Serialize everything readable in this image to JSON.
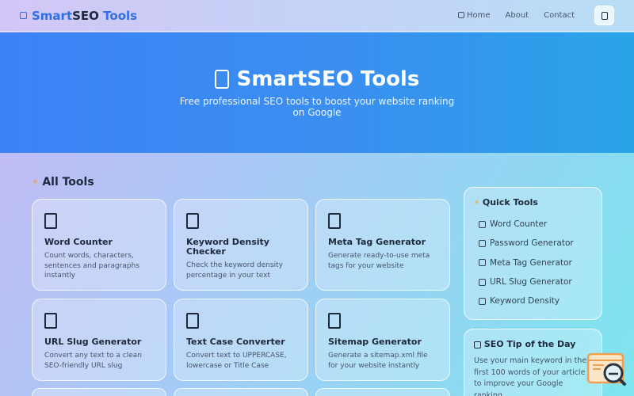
{
  "header": {
    "brand_part1": "Smart",
    "brand_part2": "SEO",
    "brand_part3": "Tools",
    "brand_icon": "rocket-icon",
    "nav": [
      {
        "label": "Home",
        "icon": "home-icon"
      },
      {
        "label": "About"
      },
      {
        "label": "Contact"
      }
    ],
    "menu_button_icon": "moon-icon"
  },
  "hero": {
    "title": "SmartSEO Tools",
    "title_icon": "rocket-icon",
    "subtitle": "Free professional SEO tools to boost your website ranking on Google"
  },
  "tools_section": {
    "title": "All Tools",
    "title_icon": "lightning-icon",
    "cards": [
      {
        "title": "Word Counter",
        "desc": "Count words, characters, sentences and paragraphs instantly",
        "icon": "notepad-icon"
      },
      {
        "title": "Keyword Density Checker",
        "desc": "Check the keyword density percentage in your text",
        "icon": "magnifier-icon"
      },
      {
        "title": "Meta Tag Generator",
        "desc": "Generate ready-to-use meta tags for your website",
        "icon": "tag-icon"
      },
      {
        "title": "URL Slug Generator",
        "desc": "Convert any text to a clean SEO-friendly URL slug",
        "icon": "link-icon"
      },
      {
        "title": "Text Case Converter",
        "desc": "Convert text to UPPERCASE, lowercase or Title Case",
        "icon": "letters-icon"
      },
      {
        "title": "Sitemap Generator",
        "desc": "Generate a sitemap.xml file for your website instantly",
        "icon": "map-icon"
      }
    ]
  },
  "quick_tools": {
    "title": "Quick Tools",
    "title_icon": "lightning-icon",
    "items": [
      {
        "label": "Word Counter",
        "icon": "notepad-icon"
      },
      {
        "label": "Password Generator",
        "icon": "key-icon"
      },
      {
        "label": "Meta Tag Generator",
        "icon": "tag-icon"
      },
      {
        "label": "URL Slug Generator",
        "icon": "link-icon"
      },
      {
        "label": "Keyword Density",
        "icon": "magnifier-icon"
      }
    ]
  },
  "seo_tip": {
    "title": "SEO Tip of the Day",
    "title_icon": "lightbulb-icon",
    "text": "Use your main keyword in the first 100 words of your article to improve your Google ranking."
  },
  "colors": {
    "accent": "#2f6fe8",
    "hero_start": "#3b82f6",
    "hero_end": "#2aa4e8",
    "badge_orange": "#f0a050"
  }
}
